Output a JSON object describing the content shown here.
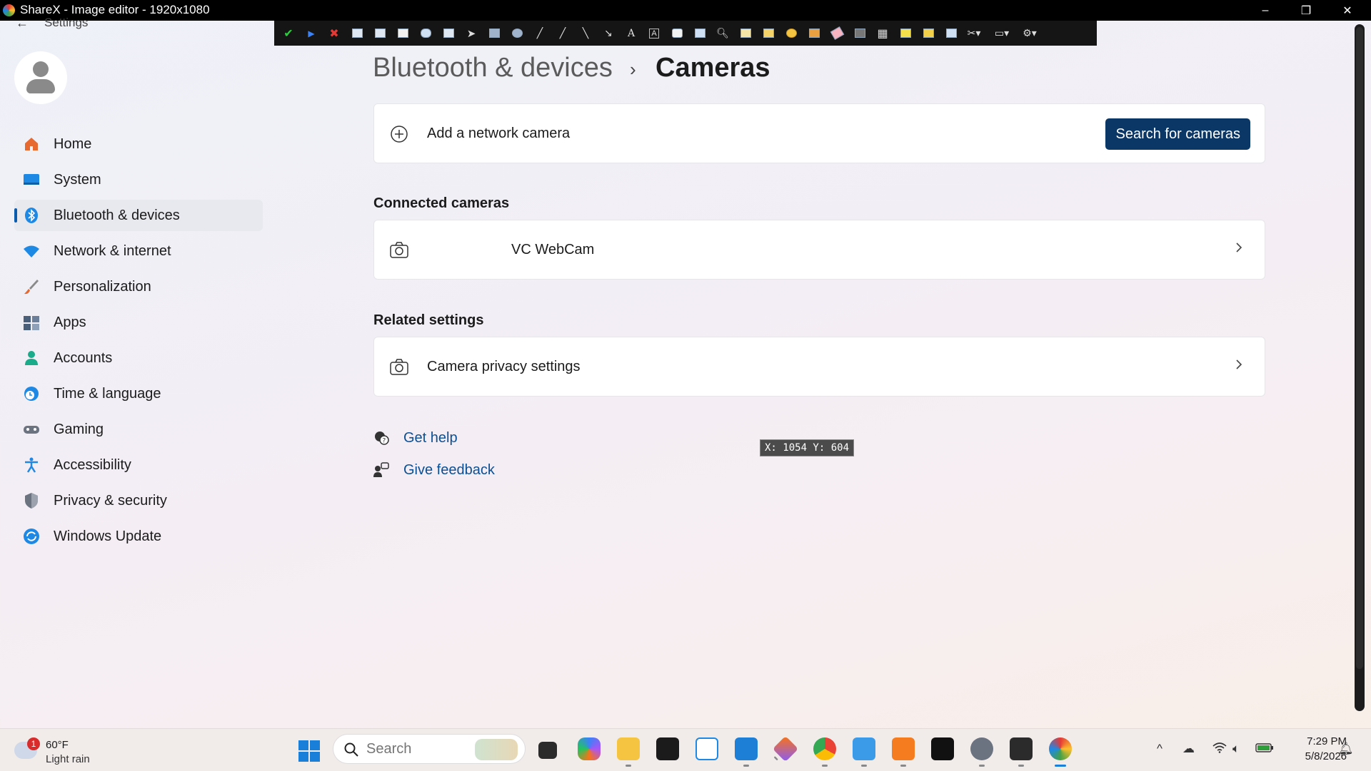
{
  "sharex": {
    "title": "ShareX - Image editor - 1920x1080",
    "window_controls": {
      "minimize": "–",
      "maximize": "❐",
      "close": "✕"
    },
    "tools": [
      "confirm-icon",
      "continue-icon",
      "cancel-icon",
      "save-icon",
      "save-as-icon",
      "copy-icon",
      "upload-icon",
      "print-icon",
      "cursor-icon",
      "rectangle-icon",
      "ellipse-icon",
      "freehand-icon",
      "smart-eraser-icon",
      "line-icon",
      "arrow-icon",
      "text-icon",
      "text-background-icon",
      "speech-balloon-icon",
      "step-icon",
      "magnify-icon",
      "image-icon",
      "sticker-icon",
      "emoji-icon",
      "cursor-insert-icon",
      "eraser-icon",
      "blur-icon",
      "pixelate-icon",
      "highlight-icon",
      "crop-icon",
      "cut-out-icon",
      "tools-dropdown-icon",
      "settings-dropdown-icon",
      "gear-icon"
    ]
  },
  "settings": {
    "back_label": "←",
    "app_label": "Settings"
  },
  "nav": {
    "items": [
      {
        "label": "Home",
        "icon": "home-icon",
        "color": "#e8692f",
        "active": false
      },
      {
        "label": "System",
        "icon": "system-icon",
        "color": "#1e88e5",
        "active": false
      },
      {
        "label": "Bluetooth & devices",
        "icon": "bluetooth-icon",
        "color": "#1e88e5",
        "active": true
      },
      {
        "label": "Network & internet",
        "icon": "wifi-icon",
        "color": "#1e88e5",
        "active": false
      },
      {
        "label": "Personalization",
        "icon": "brush-icon",
        "color": "#e8692f",
        "active": false
      },
      {
        "label": "Apps",
        "icon": "apps-icon",
        "color": "#4a5f7a",
        "active": false
      },
      {
        "label": "Accounts",
        "icon": "accounts-icon",
        "color": "#1aab8a",
        "active": false
      },
      {
        "label": "Time & language",
        "icon": "globe-clock-icon",
        "color": "#1e88e5",
        "active": false
      },
      {
        "label": "Gaming",
        "icon": "gamepad-icon",
        "color": "#6b7280",
        "active": false
      },
      {
        "label": "Accessibility",
        "icon": "accessibility-icon",
        "color": "#1e88e5",
        "active": false
      },
      {
        "label": "Privacy & security",
        "icon": "shield-icon",
        "color": "#6b7280",
        "active": false
      },
      {
        "label": "Windows Update",
        "icon": "update-icon",
        "color": "#1e88e5",
        "active": false
      }
    ]
  },
  "breadcrumb": {
    "parent": "Bluetooth & devices",
    "separator": "›",
    "current": "Cameras"
  },
  "add_camera": {
    "label": "Add a network camera",
    "button": "Search for cameras"
  },
  "connected": {
    "title": "Connected cameras",
    "items": [
      {
        "label": "VC WebCam"
      }
    ]
  },
  "related": {
    "title": "Related settings",
    "items": [
      {
        "label": "Camera privacy settings"
      }
    ]
  },
  "help": {
    "get_help": "Get help",
    "give_feedback": "Give feedback"
  },
  "cursor_readout": "X: 1054 Y: 604",
  "colors": {
    "accent": "#0b3766",
    "link": "#0b4f94",
    "nav_active_bar": "#0b5cad"
  },
  "taskbar": {
    "weather_temp": "60°F",
    "weather_desc": "Light rain",
    "weather_badge": "1",
    "search_placeholder": "Search",
    "apps": [
      "file-explorer-icon",
      "copilot-icon",
      "folder-icon",
      "terminal-dark-icon",
      "snipping-tool-icon",
      "vscode-icon",
      "git-icon",
      "chrome-icon",
      "notepad-icon",
      "xampp-icon",
      "capcut-icon",
      "settings-icon",
      "terminal-icon",
      "sharex-icon"
    ],
    "tray": {
      "chevron": "^",
      "wifi": "wifi-icon",
      "volume": "volume-icon",
      "battery": "battery-icon"
    },
    "time": "7:29 PM",
    "date": "5/8/2026"
  }
}
